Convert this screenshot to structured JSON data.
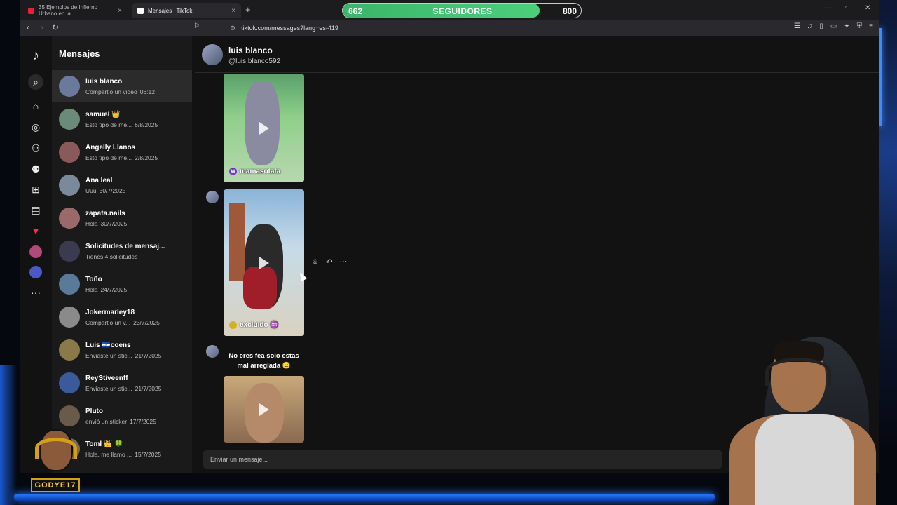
{
  "browser": {
    "tabs": [
      {
        "title": "35 Ejemplos de Infierno Urbano en la",
        "active": false
      },
      {
        "title": "Mensajes | TikTok",
        "active": true
      }
    ],
    "url": "tiktok.com/messages?lang=es-419",
    "extension_badge": "1"
  },
  "followers": {
    "current": "662",
    "label": "SEGUIDORES",
    "goal": "800",
    "progress": 0.8275
  },
  "sidebar": {
    "title": "Mensajes",
    "conversations": [
      {
        "name": "luis blanco",
        "preview": "Compartió un video",
        "time": "06:12",
        "active": true,
        "color": "#6b7a9c"
      },
      {
        "name": "samuel 👑",
        "preview": "Esto tipo de me...",
        "time": "6/8/2025",
        "color": "#6a8a7a"
      },
      {
        "name": "Angelly Llanos",
        "preview": "Esto tipo de me...",
        "time": "2/8/2025",
        "color": "#8a5a5a"
      },
      {
        "name": "Ana leal",
        "preview": "Uuu",
        "time": "30/7/2025",
        "color": "#7a8a9a"
      },
      {
        "name": "zapata.nails",
        "preview": "Hola",
        "time": "30/7/2025",
        "color": "#9a6a6a"
      },
      {
        "name": "Solicitudes de mensaj...",
        "preview": "Tienes 4 solicitudes",
        "time": "",
        "color": "#3a3a50"
      },
      {
        "name": "Toño",
        "preview": "Hola",
        "time": "24/7/2025",
        "color": "#5a7a9a"
      },
      {
        "name": "Jokermarley18",
        "preview": "Compartió un v...",
        "time": "23/7/2025",
        "color": "#8a8a8a"
      },
      {
        "name": "Luis 🇸🇻coens",
        "preview": "Enviaste un stic...",
        "time": "21/7/2025",
        "color": "#8a7a4a"
      },
      {
        "name": "ReyStiveenff",
        "preview": "Enviaste un stic...",
        "time": "21/7/2025",
        "color": "#3a5a9a"
      },
      {
        "name": "Pluto",
        "preview": "envió un sticker",
        "time": "17/7/2025",
        "color": "#6a5a4a"
      },
      {
        "name": "Toml 👑 🍀",
        "preview": "Hola, me llamo ...",
        "time": "15/7/2025",
        "color": "#7a6a5a"
      }
    ]
  },
  "chat": {
    "name": "luis blanco",
    "handle": "@luis.blanco592",
    "videos": [
      {
        "label": "mamasotata",
        "badge": "W"
      },
      {
        "label": "excluido ♒",
        "badge": ""
      },
      {
        "label": "",
        "badge": ""
      }
    ],
    "text_message": "No eres fea solo estas mal arreglada 😐",
    "input_placeholder": "Enviar un mensaje..."
  },
  "streamer": {
    "name": "GODYE17"
  },
  "icons": [
    "tiktok-logo-icon",
    "search-icon",
    "home-icon",
    "explore-icon",
    "follow-icon",
    "friends-icon",
    "upload-icon",
    "messages-icon",
    "activity-icon",
    "more-icon"
  ]
}
